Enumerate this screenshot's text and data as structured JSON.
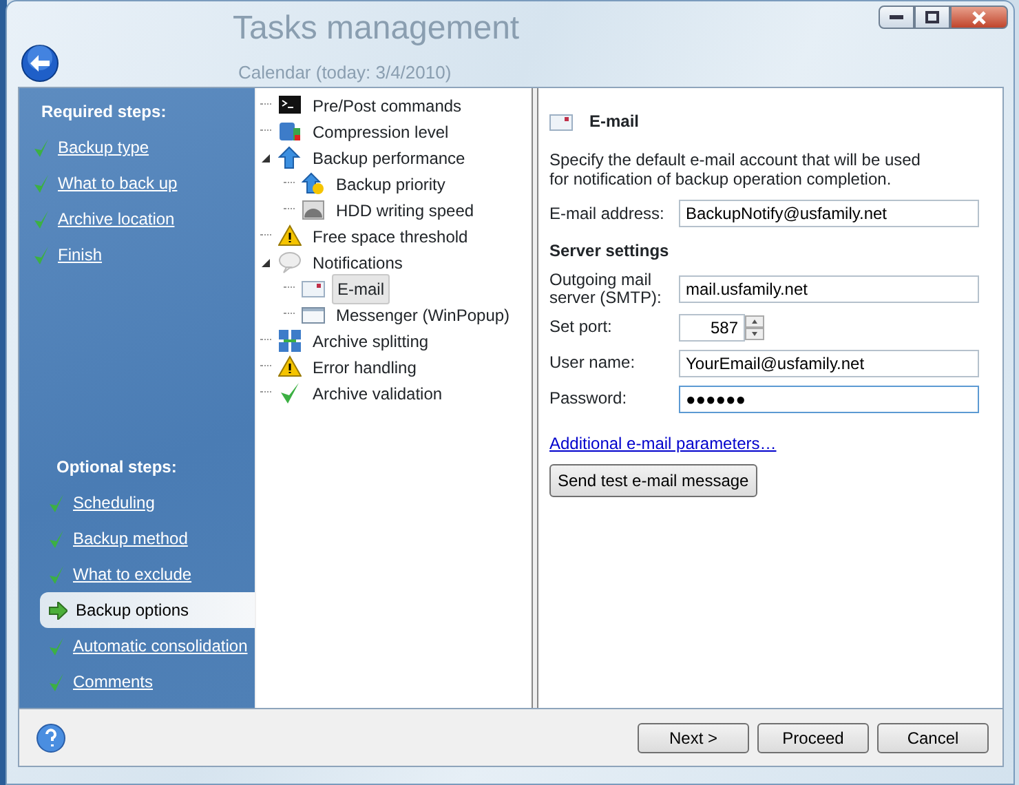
{
  "background_window": {
    "title": "Tasks management",
    "subtitle": "Calendar (today: 3/4/2010)"
  },
  "sidebar": {
    "groups": [
      {
        "heading": "Required steps:",
        "items": [
          {
            "label": "Backup type",
            "selected": false
          },
          {
            "label": "What to back up",
            "selected": false
          },
          {
            "label": "Archive location",
            "selected": false
          },
          {
            "label": "Finish",
            "selected": false
          }
        ]
      },
      {
        "heading": "Optional steps:",
        "items": [
          {
            "label": "Scheduling",
            "selected": false
          },
          {
            "label": "Backup method",
            "selected": false
          },
          {
            "label": "What to exclude",
            "selected": false
          },
          {
            "label": "Backup options",
            "selected": true
          },
          {
            "label": "Automatic consolidation",
            "selected": false
          },
          {
            "label": "Comments",
            "selected": false
          }
        ]
      }
    ]
  },
  "tree": [
    {
      "kind": "terminal",
      "label": "Pre/Post commands",
      "selected": false
    },
    {
      "kind": "compression",
      "label": "Compression level",
      "selected": false
    },
    {
      "kind": "arrow",
      "label": "Backup performance",
      "selected": false,
      "expanded": true,
      "children": [
        {
          "kind": "priority",
          "label": "Backup priority",
          "selected": false
        },
        {
          "kind": "disk",
          "label": "HDD writing speed",
          "selected": false
        }
      ]
    },
    {
      "kind": "warning",
      "label": "Free space threshold",
      "selected": false
    },
    {
      "kind": "bubble",
      "label": "Notifications",
      "selected": false,
      "expanded": true,
      "children": [
        {
          "kind": "envelope",
          "label": "E-mail",
          "selected": true
        },
        {
          "kind": "window",
          "label": "Messenger (WinPopup)",
          "selected": false
        }
      ]
    },
    {
      "kind": "split",
      "label": "Archive splitting",
      "selected": false
    },
    {
      "kind": "warning",
      "label": "Error handling",
      "selected": false
    },
    {
      "kind": "check",
      "label": "Archive validation",
      "selected": false
    }
  ],
  "panel": {
    "title": "E-mail",
    "description": "Specify the default e-mail account that will be used for notification of backup operation completion.",
    "fields": [
      {
        "kind": "text",
        "label": "E-mail address:",
        "value": "BackupNotify@usfamily.net",
        "focused": false
      },
      {
        "kind": "heading",
        "label": "Server settings"
      },
      {
        "kind": "text",
        "label": "Outgoing mail server (SMTP):",
        "value": "mail.usfamily.net",
        "focused": false
      },
      {
        "kind": "spin",
        "label": "Set port:",
        "value": "587",
        "focused": false
      },
      {
        "kind": "text",
        "label": "User name:",
        "value": "YourEmail@usfamily.net",
        "focused": false
      },
      {
        "kind": "text",
        "label": "Password:",
        "value": "●●●●●●",
        "focused": true
      }
    ],
    "link": "Additional e-mail parameters…",
    "button": "Send test e-mail message"
  },
  "footer_buttons": [
    "Next >",
    "Proceed",
    "Cancel"
  ]
}
